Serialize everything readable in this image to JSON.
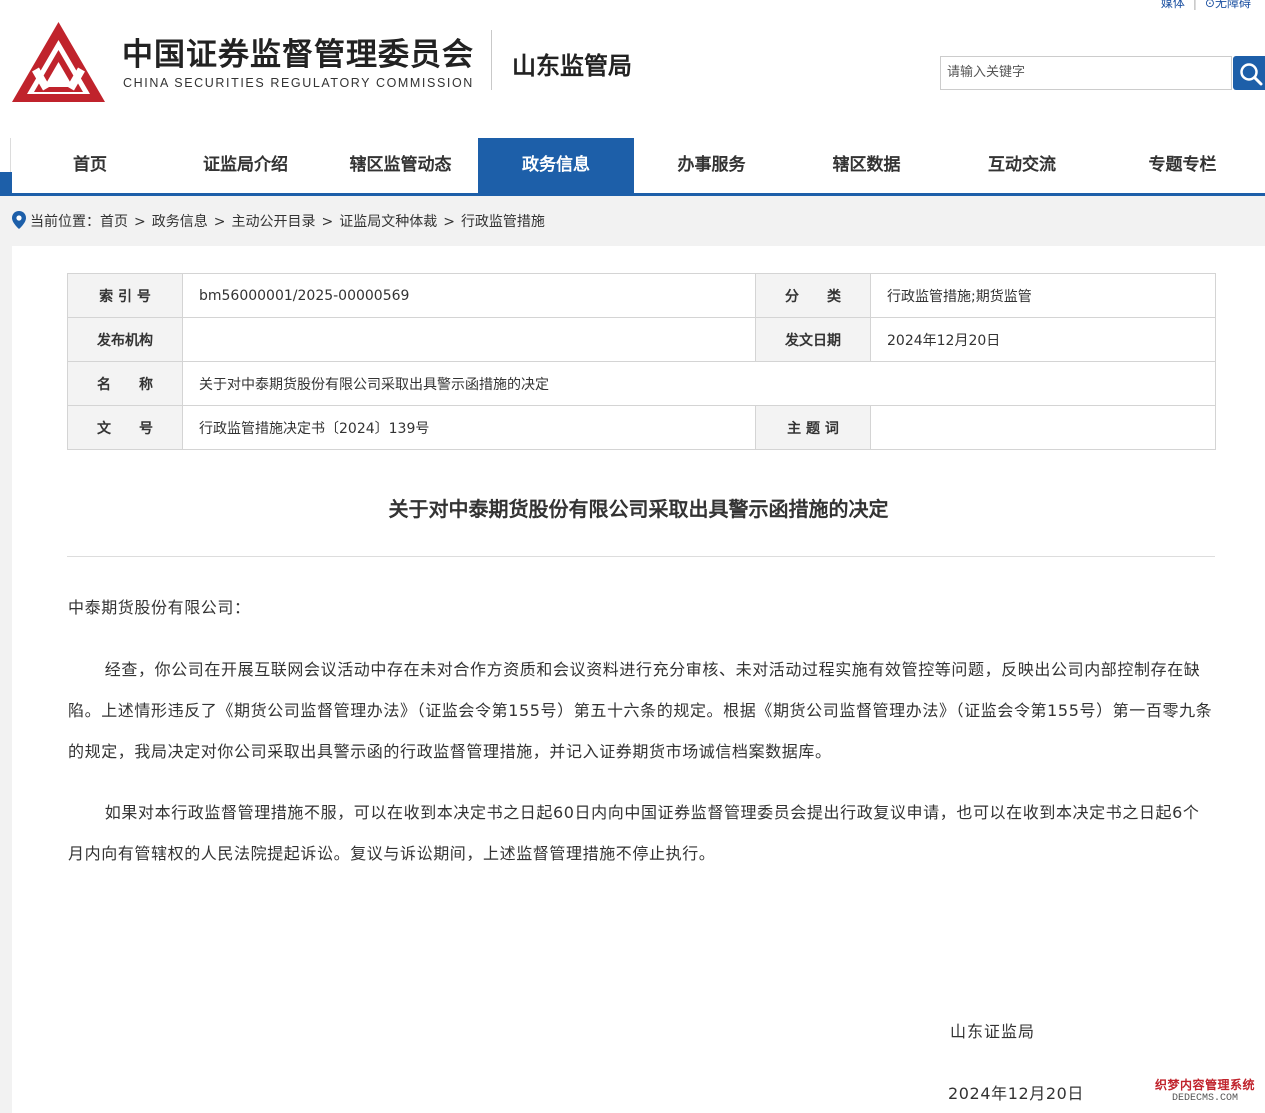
{
  "header": {
    "top_links": [
      "媒体",
      "无障碍"
    ],
    "site_title": "中国证券监督管理委员会",
    "site_subtitle": "CHINA SECURITIES REGULATORY COMMISSION",
    "bureau_name": "山东监管局",
    "search": {
      "placeholder": "请输入关键字",
      "value": ""
    },
    "brand_color": "#c0232c",
    "accent_color": "#1d5fa9"
  },
  "nav": {
    "items": [
      {
        "label": "首页",
        "active": false
      },
      {
        "label": "证监局介绍",
        "active": false
      },
      {
        "label": "辖区监管动态",
        "active": false
      },
      {
        "label": "政务信息",
        "active": true
      },
      {
        "label": "办事服务",
        "active": false
      },
      {
        "label": "辖区数据",
        "active": false
      },
      {
        "label": "互动交流",
        "active": false
      },
      {
        "label": "专题专栏",
        "active": false
      }
    ]
  },
  "breadcrumb": {
    "prefix": "当前位置：",
    "items": [
      "首页",
      "政务信息",
      "主动公开目录",
      "证监局文种体裁",
      "行政监管措施"
    ]
  },
  "info_table": {
    "index_label": "索 引 号",
    "index_value": "bm56000001/2025-00000569",
    "category_label": "分　　类",
    "category_value": "行政监管措施;期货监管",
    "publisher_label": "发布机构",
    "publisher_value": "",
    "issue_date_label": "发文日期",
    "issue_date_value": "2024年12月20日",
    "name_label": "名　　称",
    "name_value": "关于对中泰期货股份有限公司采取出具警示函措施的决定",
    "doc_no_label": "文　　号",
    "doc_no_value": "行政监管措施决定书〔2024〕139号",
    "keywords_label": "主 题 词",
    "keywords_value": ""
  },
  "document": {
    "title": "关于对中泰期货股份有限公司采取出具警示函措施的决定",
    "addressee": "中泰期货股份有限公司：",
    "paragraphs": [
      "经查，你公司在开展互联网会议活动中存在未对合作方资质和会议资料进行充分审核、未对活动过程实施有效管控等问题，反映出公司内部控制存在缺陷。上述情形违反了《期货公司监督管理办法》（证监会令第155号）第五十六条的规定。根据《期货公司监督管理办法》（证监会令第155号）第一百零九条的规定，我局决定对你公司采取出具警示函的行政监督管理措施，并记入证券期货市场诚信档案数据库。",
      "如果对本行政监督管理措施不服，可以在收到本决定书之日起60日内向中国证券监督管理委员会提出行政复议申请，也可以在收到本决定书之日起6个月内向有管辖权的人民法院提起诉讼。复议与诉讼期间，上述监督管理措施不停止执行。"
    ],
    "signer": "山东证监局",
    "date": "2024年12月20日"
  },
  "watermark": {
    "cn": "织梦内容管理系统",
    "en": "DEDECMS.COM"
  }
}
